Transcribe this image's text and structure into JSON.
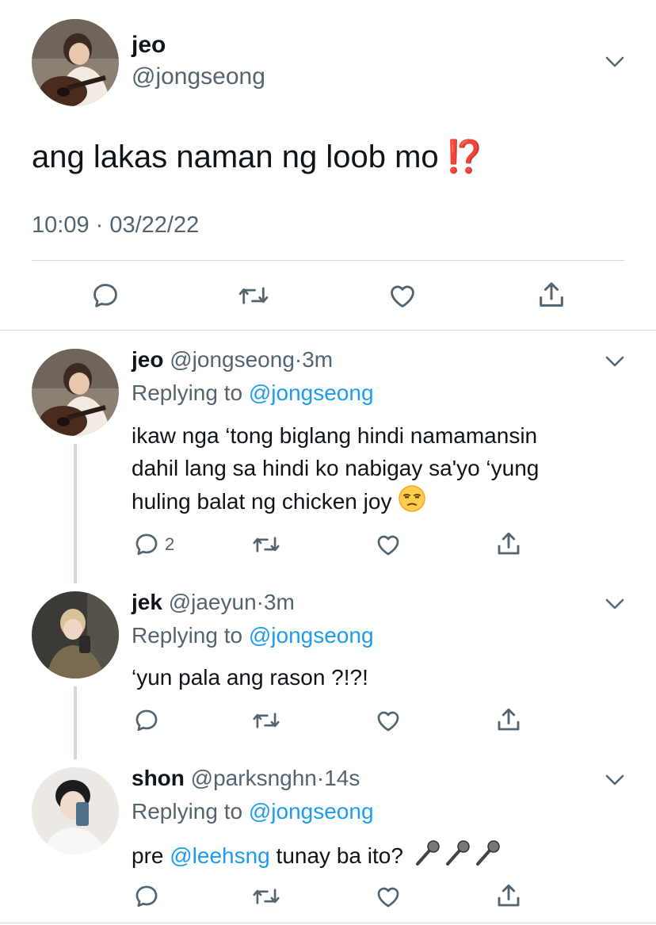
{
  "main_tweet": {
    "name": "jeo",
    "handle": "@jongseong",
    "text": "ang lakas naman ng loob mo",
    "emoji": "⁉️",
    "timestamp": "10:09 · 03/22/22",
    "actions": [
      "reply-icon",
      "retweet-icon",
      "like-icon",
      "share-icon"
    ]
  },
  "replies": [
    {
      "name": "jeo",
      "handle": "@jongseong",
      "sep": "·",
      "time": "3m",
      "replying_prefix": "Replying to ",
      "replying_to": "@jongseong",
      "lines": [
        "ikaw nga ‘tong biglang hindi namamansin",
        "dahil lang sa hindi ko nabigay sa'yo ‘yung",
        "huling balat ng chicken joy"
      ],
      "emoji": "unamused-face-icon",
      "reply_count": "2"
    },
    {
      "name": "jek",
      "handle": "@jaeyun",
      "sep": "·",
      "time": "3m",
      "replying_prefix": "Replying to ",
      "replying_to": "@jongseong",
      "lines": [
        "‘yun pala ang rason ?!?!"
      ],
      "reply_count": ""
    },
    {
      "name": "shon",
      "handle": "@parksnghn",
      "sep": "·",
      "time": "14s",
      "replying_prefix": "Replying to ",
      "replying_to": "@jongseong",
      "text_before": "pre ",
      "mention": "@leehsng",
      "text_after": " tunay ba ito?",
      "emoji": "microphone-icon",
      "reply_count": ""
    }
  ],
  "colors": {
    "text": "#0f1419",
    "secondary": "#536471",
    "link": "#1d9bf0",
    "divider": "#cfd9de",
    "interrobang": "#e0241a"
  }
}
